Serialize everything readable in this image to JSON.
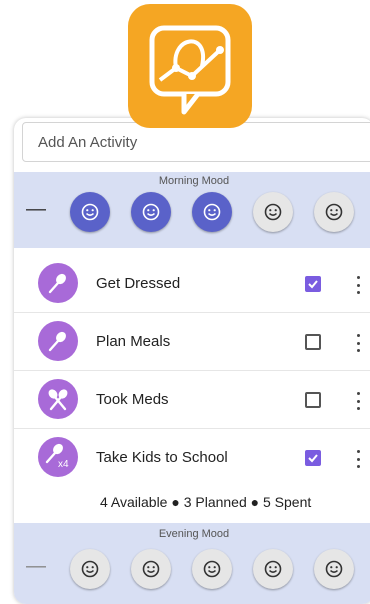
{
  "app": {
    "logo_icon": "chart-speech-bubble-logo",
    "accent": "#f5a623",
    "primary": "#5a62c9",
    "activity_color": "#a86ad8"
  },
  "add_activity": {
    "placeholder": "Add An Activity"
  },
  "morning_mood": {
    "title": "Morning Mood",
    "minus": "—",
    "selected_level": 3,
    "faces": [
      "smiley-icon",
      "smiley-icon",
      "smiley-icon",
      "smiley-icon",
      "smiley-icon"
    ]
  },
  "activities": [
    {
      "label": "Get Dressed",
      "icon": "spoon-icon",
      "checked": true
    },
    {
      "label": "Plan Meals",
      "icon": "spoon-icon",
      "checked": false
    },
    {
      "label": "Took Meds",
      "icon": "crossed-spoons-icon",
      "checked": false
    },
    {
      "label": "Take Kids to School",
      "icon": "spoon-icon",
      "badge": "x4",
      "checked": true
    }
  ],
  "summary": "4 Available ● 3 Planned ● 5 Spent",
  "evening_mood": {
    "title": "Evening Mood",
    "minus": "—",
    "selected_level": 0,
    "faces": [
      "smiley-icon",
      "smiley-icon",
      "smiley-icon",
      "smiley-icon",
      "smiley-icon"
    ]
  }
}
